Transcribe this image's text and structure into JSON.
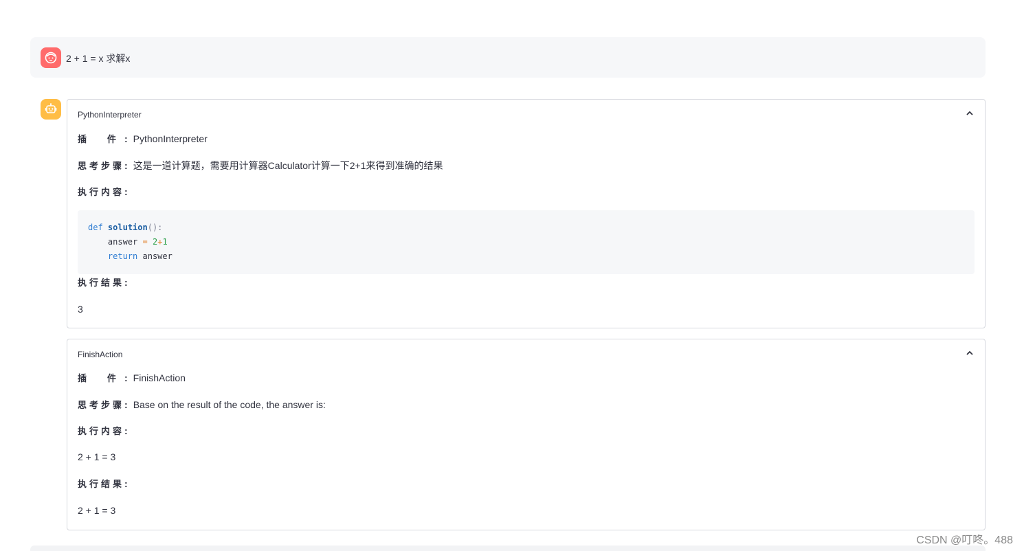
{
  "user_message": {
    "avatar_icon": "user-face-icon",
    "avatar_color": "#ff6b6b",
    "text": "2 + 1 = x 求解x"
  },
  "assistant": {
    "avatar_icon": "robot-icon",
    "avatar_color": "#ffbd45",
    "steps": [
      {
        "header": "PythonInterpreter",
        "plugin_label_1": "插",
        "plugin_label_2": "件",
        "plugin_value": "PythonInterpreter",
        "thought_label": "思考步骤",
        "thought_value": "这是一道计算题，需要用计算器Calculator计算一下2+1来得到准确的结果",
        "content_label": "执行内容",
        "code": {
          "l1_kw": "def",
          "l1_fn": "solution",
          "l1_punc": "():",
          "l2_var": "answer",
          "l2_op": "=",
          "l2_n1": "2",
          "l2_plus": "+",
          "l2_n2": "1",
          "l3_kw": "return",
          "l3_var": "answer"
        },
        "result_label": "执行结果",
        "result_value": "3"
      },
      {
        "header": "FinishAction",
        "plugin_label_1": "插",
        "plugin_label_2": "件",
        "plugin_value": "FinishAction",
        "thought_label": "思考步骤",
        "thought_value": "Base on the result of the code, the answer is:",
        "content_label": "执行内容",
        "content_value": "2 + 1 = 3",
        "result_label": "执行结果",
        "result_value": "2 + 1 = 3"
      }
    ]
  },
  "watermark": "CSDN @叮咚。488"
}
